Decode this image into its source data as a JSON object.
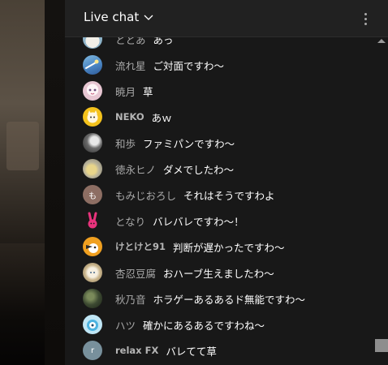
{
  "header": {
    "title": "Live chat"
  },
  "messages": [
    {
      "author": "ととあ",
      "text": "あっ",
      "avatar": "cloud-avatar",
      "bold": false
    },
    {
      "author": "流れ星",
      "text": "ご対面ですわ〜",
      "avatar": "shooting-star-avatar",
      "bold": false
    },
    {
      "author": "暁月",
      "text": "草",
      "avatar": "anime-girl-avatar",
      "bold": false
    },
    {
      "author": "NEKO",
      "text": "あｗ",
      "avatar": "cat-avatar",
      "bold": true
    },
    {
      "author": "和歩",
      "text": "ファミパンですわ～",
      "avatar": "gray-figure-avatar",
      "bold": false
    },
    {
      "author": "徳永ヒノ",
      "text": "ダメでしたわ～",
      "avatar": "yellow-flower-avatar",
      "bold": false
    },
    {
      "author": "もみじおろし",
      "text": "それはそうですわよ",
      "avatar": "letter-avatar",
      "letter": "も",
      "bold": false
    },
    {
      "author": "となり",
      "text": "バレバレですわ～！",
      "avatar": "pink-rabbit-avatar",
      "bold": false
    },
    {
      "author": "けとけと91",
      "text": "判断が遅かったですわ～",
      "avatar": "orange-character-avatar",
      "bold": false
    },
    {
      "author": "杏忍豆腐",
      "text": "おハーブ生えましたわ〜",
      "avatar": "anime-character-avatar",
      "bold": false
    },
    {
      "author": "秋乃音",
      "text": "ホラゲーあるあるド無能ですわ〜",
      "avatar": "dark-green-avatar",
      "bold": false
    },
    {
      "author": "ハツ",
      "text": "確かにあるあるですわね〜",
      "avatar": "blue-creature-avatar",
      "bold": false
    },
    {
      "author": "relax FX",
      "text": "バレてて草",
      "avatar": "letter-avatar",
      "letter": "r",
      "bold": true
    }
  ],
  "colors": {
    "panel_bg": "#181818",
    "header_bg": "#212121",
    "author": "#aaaaaa",
    "message": "#ffffff"
  }
}
